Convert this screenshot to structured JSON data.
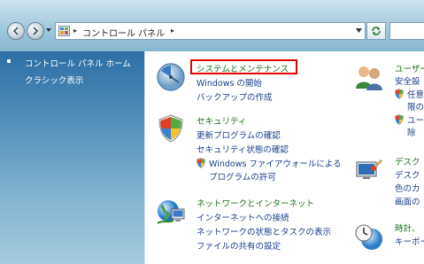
{
  "address": {
    "crumb": "コントロール パネル"
  },
  "sidebar": {
    "home": "コントロール パネル ホーム",
    "classic": "クラシック表示"
  },
  "categories": {
    "system": {
      "title": "システムとメンテナンス",
      "links": [
        "Windows の開始",
        "バックアップの作成"
      ]
    },
    "security": {
      "title": "セキュリティ",
      "links": [
        "更新プログラムの確認",
        "セキュリティ状態の確認",
        "Windows ファイアウォールによる",
        "プログラムの許可"
      ]
    },
    "network": {
      "title": "ネットワークとインターネット",
      "links": [
        "インターネットへの接続",
        "ネットワークの状態とタスクの表示",
        "ファイルの共有の設定"
      ]
    },
    "user": {
      "title": "ユーザー",
      "links": [
        "安全設",
        "任意",
        "限の",
        "ユー",
        "除"
      ]
    },
    "desktop": {
      "title": "デスク",
      "links": [
        "デスク",
        "色のカ",
        "画面の"
      ]
    },
    "clock": {
      "title": "時計、",
      "links": [
        "キーボー"
      ]
    }
  },
  "colors": {
    "highlight": "#e60000",
    "category_green": "#1b6e1b",
    "link_blue": "#1a3e8a"
  }
}
